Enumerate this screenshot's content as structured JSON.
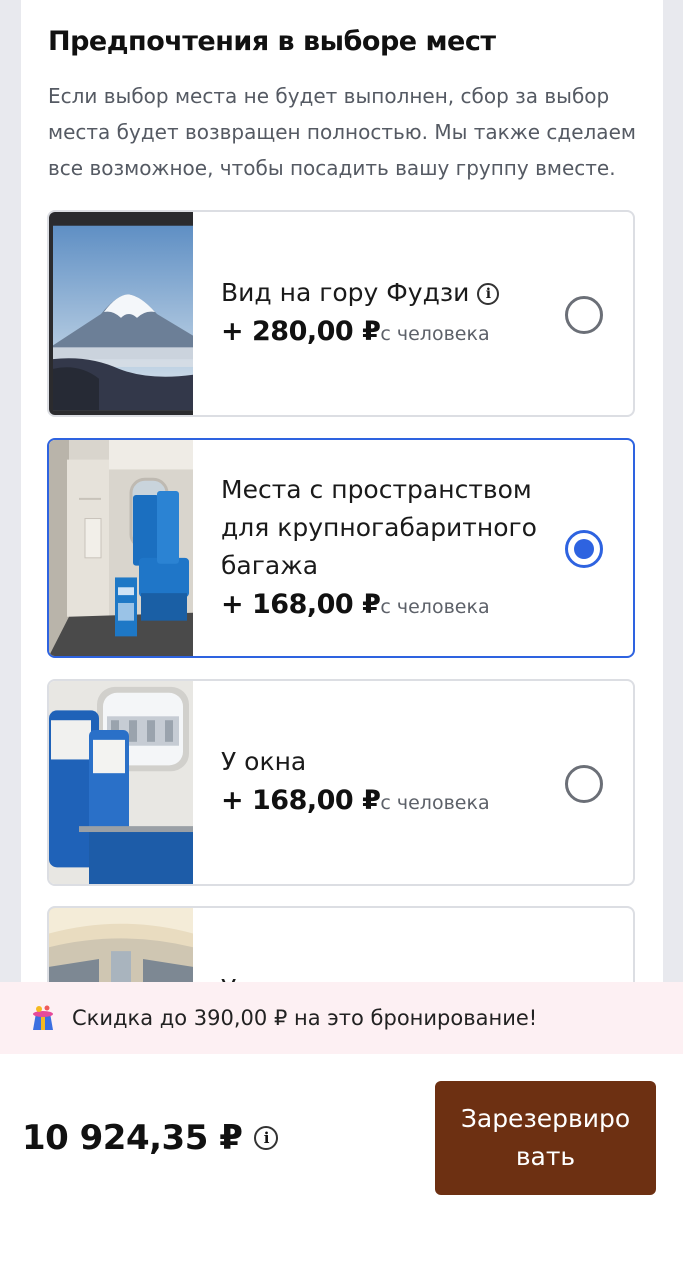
{
  "section": {
    "title": "Предпочтения в выборе мест",
    "description": "Если выбор места не будет выполнен, сбор за выбор места будет возвращен полностью. Мы также сделаем все возможное, чтобы посадить вашу группу вместе."
  },
  "options": [
    {
      "title": "Вид на гору Фудзи",
      "price": "+ 280,00 ₽",
      "unit": "с человека",
      "selected": false,
      "image": "mount-fuji-view"
    },
    {
      "title": "Места с пространством для крупногабаритного багажа",
      "price": "+ 168,00 ₽",
      "unit": "с человека",
      "selected": true,
      "image": "luggage-space-seat"
    },
    {
      "title": "У окна",
      "price": "+ 168,00 ₽",
      "unit": "с человека",
      "selected": false,
      "image": "window-seat"
    },
    {
      "title": "У",
      "image": "train-aisle"
    }
  ],
  "promo": {
    "text": "Скидка до 390,00 ₽ на это бронирование!",
    "icon": "gift-hat-icon"
  },
  "footer": {
    "total": "10 924,35 ₽",
    "reserve_label": "Зарезервиро вать"
  },
  "colors": {
    "accent": "#2e63e0",
    "button": "#6d3012",
    "promo_bg": "#fdf0f3"
  }
}
